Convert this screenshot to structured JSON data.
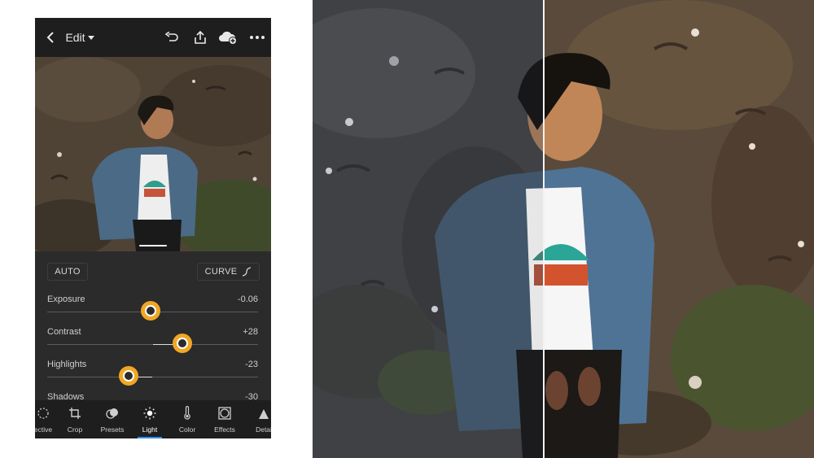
{
  "topbar": {
    "edit_label": "Edit",
    "icons": [
      "back-chevron-icon",
      "undo-icon",
      "share-icon",
      "cloud-add-icon",
      "more-icon"
    ]
  },
  "panel": {
    "auto_label": "AUTO",
    "curve_label": "CURVE",
    "sliders": [
      {
        "label": "Exposure",
        "value": "-0.06",
        "level": 0.49
      },
      {
        "label": "Contrast",
        "value": "+28",
        "level": 0.64
      },
      {
        "label": "Highlights",
        "value": "-23",
        "level": 0.385
      },
      {
        "label": "Shadows",
        "value": "-30"
      }
    ]
  },
  "tabs": [
    {
      "label": "ective",
      "icon": "selective-icon"
    },
    {
      "label": "Crop",
      "icon": "crop-icon"
    },
    {
      "label": "Presets",
      "icon": "presets-icon"
    },
    {
      "label": "Light",
      "icon": "sun-icon",
      "active": true
    },
    {
      "label": "Color",
      "icon": "thermometer-icon"
    },
    {
      "label": "Effects",
      "icon": "effects-icon"
    },
    {
      "label": "Detai",
      "icon": "detail-icon"
    }
  ],
  "colors": {
    "accent": "#f0a724",
    "active_tab": "#2c8ef8",
    "app_background": "#1e1e1e",
    "panel_background": "#2b2b2b"
  }
}
